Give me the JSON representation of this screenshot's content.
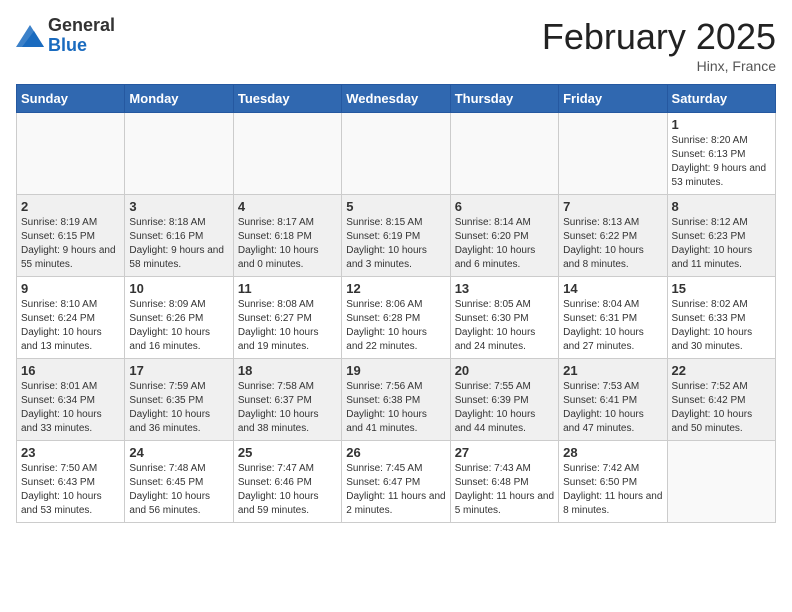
{
  "header": {
    "logo_general": "General",
    "logo_blue": "Blue",
    "title": "February 2025",
    "subtitle": "Hinx, France"
  },
  "weekdays": [
    "Sunday",
    "Monday",
    "Tuesday",
    "Wednesday",
    "Thursday",
    "Friday",
    "Saturday"
  ],
  "weeks": [
    [
      {
        "day": "",
        "info": ""
      },
      {
        "day": "",
        "info": ""
      },
      {
        "day": "",
        "info": ""
      },
      {
        "day": "",
        "info": ""
      },
      {
        "day": "",
        "info": ""
      },
      {
        "day": "",
        "info": ""
      },
      {
        "day": "1",
        "info": "Sunrise: 8:20 AM\nSunset: 6:13 PM\nDaylight: 9 hours and 53 minutes."
      }
    ],
    [
      {
        "day": "2",
        "info": "Sunrise: 8:19 AM\nSunset: 6:15 PM\nDaylight: 9 hours and 55 minutes."
      },
      {
        "day": "3",
        "info": "Sunrise: 8:18 AM\nSunset: 6:16 PM\nDaylight: 9 hours and 58 minutes."
      },
      {
        "day": "4",
        "info": "Sunrise: 8:17 AM\nSunset: 6:18 PM\nDaylight: 10 hours and 0 minutes."
      },
      {
        "day": "5",
        "info": "Sunrise: 8:15 AM\nSunset: 6:19 PM\nDaylight: 10 hours and 3 minutes."
      },
      {
        "day": "6",
        "info": "Sunrise: 8:14 AM\nSunset: 6:20 PM\nDaylight: 10 hours and 6 minutes."
      },
      {
        "day": "7",
        "info": "Sunrise: 8:13 AM\nSunset: 6:22 PM\nDaylight: 10 hours and 8 minutes."
      },
      {
        "day": "8",
        "info": "Sunrise: 8:12 AM\nSunset: 6:23 PM\nDaylight: 10 hours and 11 minutes."
      }
    ],
    [
      {
        "day": "9",
        "info": "Sunrise: 8:10 AM\nSunset: 6:24 PM\nDaylight: 10 hours and 13 minutes."
      },
      {
        "day": "10",
        "info": "Sunrise: 8:09 AM\nSunset: 6:26 PM\nDaylight: 10 hours and 16 minutes."
      },
      {
        "day": "11",
        "info": "Sunrise: 8:08 AM\nSunset: 6:27 PM\nDaylight: 10 hours and 19 minutes."
      },
      {
        "day": "12",
        "info": "Sunrise: 8:06 AM\nSunset: 6:28 PM\nDaylight: 10 hours and 22 minutes."
      },
      {
        "day": "13",
        "info": "Sunrise: 8:05 AM\nSunset: 6:30 PM\nDaylight: 10 hours and 24 minutes."
      },
      {
        "day": "14",
        "info": "Sunrise: 8:04 AM\nSunset: 6:31 PM\nDaylight: 10 hours and 27 minutes."
      },
      {
        "day": "15",
        "info": "Sunrise: 8:02 AM\nSunset: 6:33 PM\nDaylight: 10 hours and 30 minutes."
      }
    ],
    [
      {
        "day": "16",
        "info": "Sunrise: 8:01 AM\nSunset: 6:34 PM\nDaylight: 10 hours and 33 minutes."
      },
      {
        "day": "17",
        "info": "Sunrise: 7:59 AM\nSunset: 6:35 PM\nDaylight: 10 hours and 36 minutes."
      },
      {
        "day": "18",
        "info": "Sunrise: 7:58 AM\nSunset: 6:37 PM\nDaylight: 10 hours and 38 minutes."
      },
      {
        "day": "19",
        "info": "Sunrise: 7:56 AM\nSunset: 6:38 PM\nDaylight: 10 hours and 41 minutes."
      },
      {
        "day": "20",
        "info": "Sunrise: 7:55 AM\nSunset: 6:39 PM\nDaylight: 10 hours and 44 minutes."
      },
      {
        "day": "21",
        "info": "Sunrise: 7:53 AM\nSunset: 6:41 PM\nDaylight: 10 hours and 47 minutes."
      },
      {
        "day": "22",
        "info": "Sunrise: 7:52 AM\nSunset: 6:42 PM\nDaylight: 10 hours and 50 minutes."
      }
    ],
    [
      {
        "day": "23",
        "info": "Sunrise: 7:50 AM\nSunset: 6:43 PM\nDaylight: 10 hours and 53 minutes."
      },
      {
        "day": "24",
        "info": "Sunrise: 7:48 AM\nSunset: 6:45 PM\nDaylight: 10 hours and 56 minutes."
      },
      {
        "day": "25",
        "info": "Sunrise: 7:47 AM\nSunset: 6:46 PM\nDaylight: 10 hours and 59 minutes."
      },
      {
        "day": "26",
        "info": "Sunrise: 7:45 AM\nSunset: 6:47 PM\nDaylight: 11 hours and 2 minutes."
      },
      {
        "day": "27",
        "info": "Sunrise: 7:43 AM\nSunset: 6:48 PM\nDaylight: 11 hours and 5 minutes."
      },
      {
        "day": "28",
        "info": "Sunrise: 7:42 AM\nSunset: 6:50 PM\nDaylight: 11 hours and 8 minutes."
      },
      {
        "day": "",
        "info": ""
      }
    ]
  ]
}
